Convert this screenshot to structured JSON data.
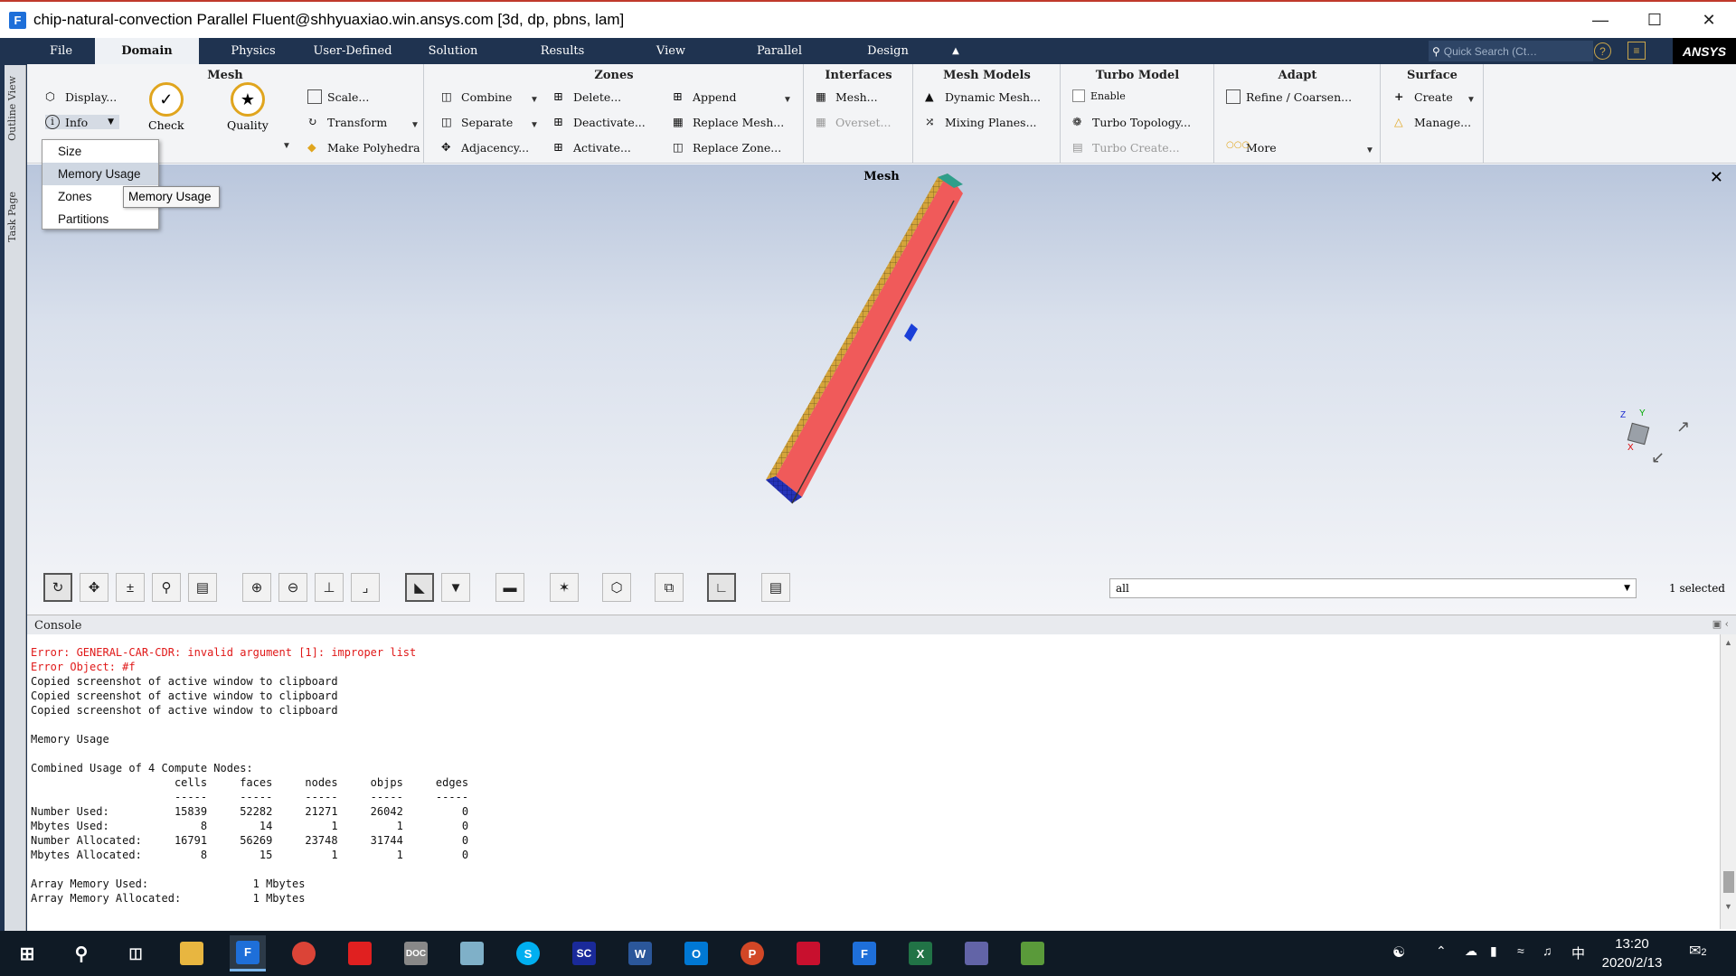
{
  "window": {
    "title": "chip-natural-convection Parallel Fluent@shhyuaxiao.win.ansys.com  [3d, dp, pbns, lam]",
    "app_icon": "F"
  },
  "menu_tabs": [
    "File",
    "Domain",
    "Physics",
    "User-Defined",
    "Solution",
    "Results",
    "View",
    "Parallel",
    "Design"
  ],
  "active_tab": "Domain",
  "quick_search": {
    "placeholder": "Quick Search (Ct…"
  },
  "brand": "ANSYS",
  "side_tabs": {
    "outline": "Outline View",
    "task": "Task Page"
  },
  "ribbon": {
    "mesh": {
      "title": "Mesh",
      "display": "Display...",
      "info": "Info",
      "check": "Check",
      "quality": "Quality",
      "scale": "Scale...",
      "transform": "Transform",
      "make_polyhedra": "Make Polyhedra"
    },
    "zones": {
      "title": "Zones",
      "combine": "Combine",
      "separate": "Separate",
      "adjacency": "Adjacency...",
      "delete": "Delete...",
      "deactivate": "Deactivate...",
      "activate": "Activate...",
      "append": "Append",
      "replace_mesh": "Replace Mesh...",
      "replace_zone": "Replace Zone..."
    },
    "interfaces": {
      "title": "Interfaces",
      "mesh": "Mesh...",
      "overset": "Overset..."
    },
    "mesh_models": {
      "title": "Mesh Models",
      "dynamic_mesh": "Dynamic Mesh...",
      "mixing_planes": "Mixing Planes..."
    },
    "turbo_model": {
      "title": "Turbo Model",
      "enable": "Enable",
      "turbo_topology": "Turbo Topology...",
      "turbo_create": "Turbo Create..."
    },
    "adapt": {
      "title": "Adapt",
      "refine": "Refine / Coarsen...",
      "more": "More"
    },
    "surface": {
      "title": "Surface",
      "create": "Create",
      "manage": "Manage..."
    }
  },
  "info_menu": {
    "items": [
      "Size",
      "Memory Usage",
      "Zones",
      "Partitions"
    ],
    "highlighted": "Memory Usage",
    "tooltip": "Memory Usage"
  },
  "viewport": {
    "title": "Mesh"
  },
  "selection": {
    "value": "all",
    "count": "1 selected"
  },
  "console": {
    "title": "Console",
    "lines": [
      {
        "text": "Error: GENERAL-CAR-CDR: invalid argument [1]: improper list",
        "error": true
      },
      {
        "text": "Error Object: #f",
        "error": true
      },
      {
        "text": "Copied screenshot of active window to clipboard",
        "error": false
      },
      {
        "text": "Copied screenshot of active window to clipboard",
        "error": false
      },
      {
        "text": "Copied screenshot of active window to clipboard",
        "error": false
      },
      {
        "text": "",
        "error": false
      },
      {
        "text": "Memory Usage",
        "error": false
      },
      {
        "text": "",
        "error": false
      },
      {
        "text": "Combined Usage of 4 Compute Nodes:",
        "error": false
      },
      {
        "text": "                      cells     faces     nodes     objps     edges",
        "error": false
      },
      {
        "text": "                      -----     -----     -----     -----     -----",
        "error": false
      },
      {
        "text": "Number Used:          15839     52282     21271     26042         0",
        "error": false
      },
      {
        "text": "Mbytes Used:              8        14         1         1         0",
        "error": false
      },
      {
        "text": "Number Allocated:     16791     56269     23748     31744         0",
        "error": false
      },
      {
        "text": "Mbytes Allocated:         8        15         1         1         0",
        "error": false
      },
      {
        "text": "",
        "error": false
      },
      {
        "text": "Array Memory Used:                1 Mbytes",
        "error": false
      },
      {
        "text": "Array Memory Allocated:           1 Mbytes",
        "error": false
      }
    ]
  },
  "taskbar": {
    "time": "13:20",
    "date": "2020/2/13",
    "ime": "中",
    "notifications": "2"
  }
}
